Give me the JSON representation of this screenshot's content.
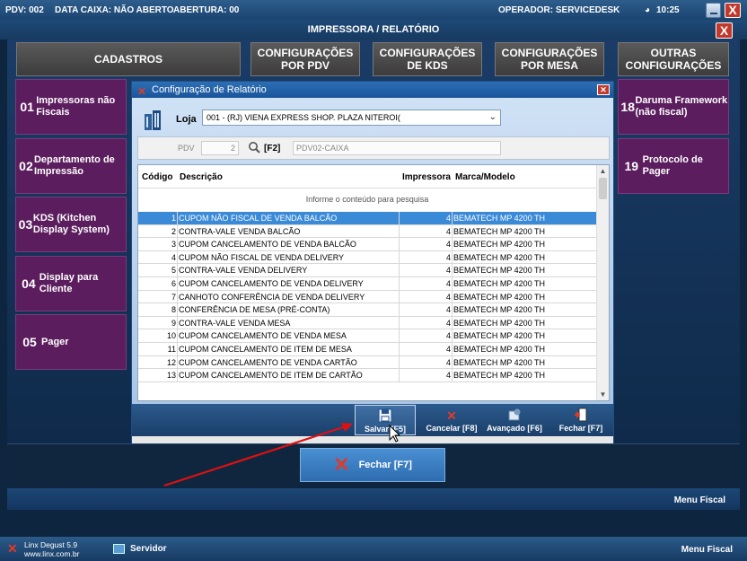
{
  "status": {
    "pdv": "PDV: 002",
    "data_caixa": "DATA CAIXA: NÃO ABERTO",
    "abertura": "ABERTURA: 00",
    "operador": "OPERADOR: SERVICEDESK",
    "clock": "10:25",
    "close_label": "X"
  },
  "window": {
    "title": "IMPRESSORA / RELATÓRIO",
    "close_label": "X"
  },
  "categories": [
    {
      "label": "CADASTROS"
    },
    {
      "label": "CONFIGURAÇÕES POR PDV"
    },
    {
      "label": "CONFIGURAÇÕES DE KDS"
    },
    {
      "label": "CONFIGURAÇÕES POR MESA"
    },
    {
      "label": "OUTRAS CONFIGURAÇÕES"
    }
  ],
  "left_tiles": [
    {
      "num": "01",
      "label": "Impressoras não Fiscais"
    },
    {
      "num": "02",
      "label": "Departamento de Impressão"
    },
    {
      "num": "03",
      "label": "KDS (Kitchen Display System)"
    },
    {
      "num": "04",
      "label": "Display para Cliente"
    },
    {
      "num": "05",
      "label": "Pager"
    }
  ],
  "right_tiles": [
    {
      "num": "18",
      "label": "Daruma Framework (não fiscal)"
    },
    {
      "num": "19",
      "label": "Protocolo de Pager"
    }
  ],
  "dialog": {
    "title": "Configuração de Relatório",
    "loja_label": "Loja",
    "loja_value": "001 - (RJ) VIENA EXPRESS  SHOP. PLAZA NITEROI(",
    "pdv_label": "PDV",
    "pdv_value": "2",
    "f2_label": "[F2]",
    "pdv_name": "PDV02-CAIXA",
    "columns": [
      "Código",
      "Descrição",
      "Impressora",
      "Marca/Modelo"
    ],
    "hint": "Informe o conteúdo para pesquisa",
    "rows": [
      {
        "codigo": "1",
        "descricao": "CUPOM NÃO FISCAL DE VENDA BALCÃO",
        "impressora": "4",
        "modelo": "BEMATECH MP 4200 TH"
      },
      {
        "codigo": "2",
        "descricao": "CONTRA-VALE VENDA BALCÃO",
        "impressora": "4",
        "modelo": "BEMATECH MP 4200 TH"
      },
      {
        "codigo": "3",
        "descricao": "CUPOM CANCELAMENTO DE VENDA BALCÃO",
        "impressora": "4",
        "modelo": "BEMATECH MP 4200 TH"
      },
      {
        "codigo": "4",
        "descricao": "CUPOM NÃO FISCAL DE VENDA DELIVERY",
        "impressora": "4",
        "modelo": "BEMATECH MP 4200 TH"
      },
      {
        "codigo": "5",
        "descricao": "CONTRA-VALE VENDA DELIVERY",
        "impressora": "4",
        "modelo": "BEMATECH MP 4200 TH"
      },
      {
        "codigo": "6",
        "descricao": "CUPOM CANCELAMENTO DE VENDA DELIVERY",
        "impressora": "4",
        "modelo": "BEMATECH MP 4200 TH"
      },
      {
        "codigo": "7",
        "descricao": "CANHOTO CONFERÊNCIA DE VENDA DELIVERY",
        "impressora": "4",
        "modelo": "BEMATECH MP 4200 TH"
      },
      {
        "codigo": "8",
        "descricao": "CONFERÊNCIA DE MESA (PRÉ-CONTA)",
        "impressora": "4",
        "modelo": "BEMATECH MP 4200 TH"
      },
      {
        "codigo": "9",
        "descricao": "CONTRA-VALE VENDA MESA",
        "impressora": "4",
        "modelo": "BEMATECH MP 4200 TH"
      },
      {
        "codigo": "10",
        "descricao": "CUPOM CANCELAMENTO DE VENDA MESA",
        "impressora": "4",
        "modelo": "BEMATECH MP 4200 TH"
      },
      {
        "codigo": "11",
        "descricao": "CUPOM CANCELAMENTO DE ITEM DE MESA",
        "impressora": "4",
        "modelo": "BEMATECH MP 4200 TH"
      },
      {
        "codigo": "12",
        "descricao": "CUPOM CANCELAMENTO DE VENDA CARTÃO",
        "impressora": "4",
        "modelo": "BEMATECH MP 4200 TH"
      },
      {
        "codigo": "13",
        "descricao": "CUPOM CANCELAMENTO DE ITEM DE CARTÃO",
        "impressora": "4",
        "modelo": "BEMATECH MP 4200 TH"
      }
    ],
    "buttons": {
      "salvar": "Salvar [F5]",
      "cancelar": "Cancelar [F8]",
      "avancado": "Avançado [F6]",
      "fechar": "Fechar [F7]"
    }
  },
  "main_close": "Fechar [F7]",
  "menu_fiscal": "Menu Fiscal",
  "footer": {
    "app_name": "Linx Degust  5.9",
    "app_url": "www.linx.com.br",
    "server": "Servidor",
    "menu_fiscal": "Menu Fiscal"
  },
  "colors": {
    "tile": "#5b1d5e",
    "selected_row": "#3b8ad8",
    "close": "#c2382b",
    "annotation_arrow": "#e01010"
  }
}
